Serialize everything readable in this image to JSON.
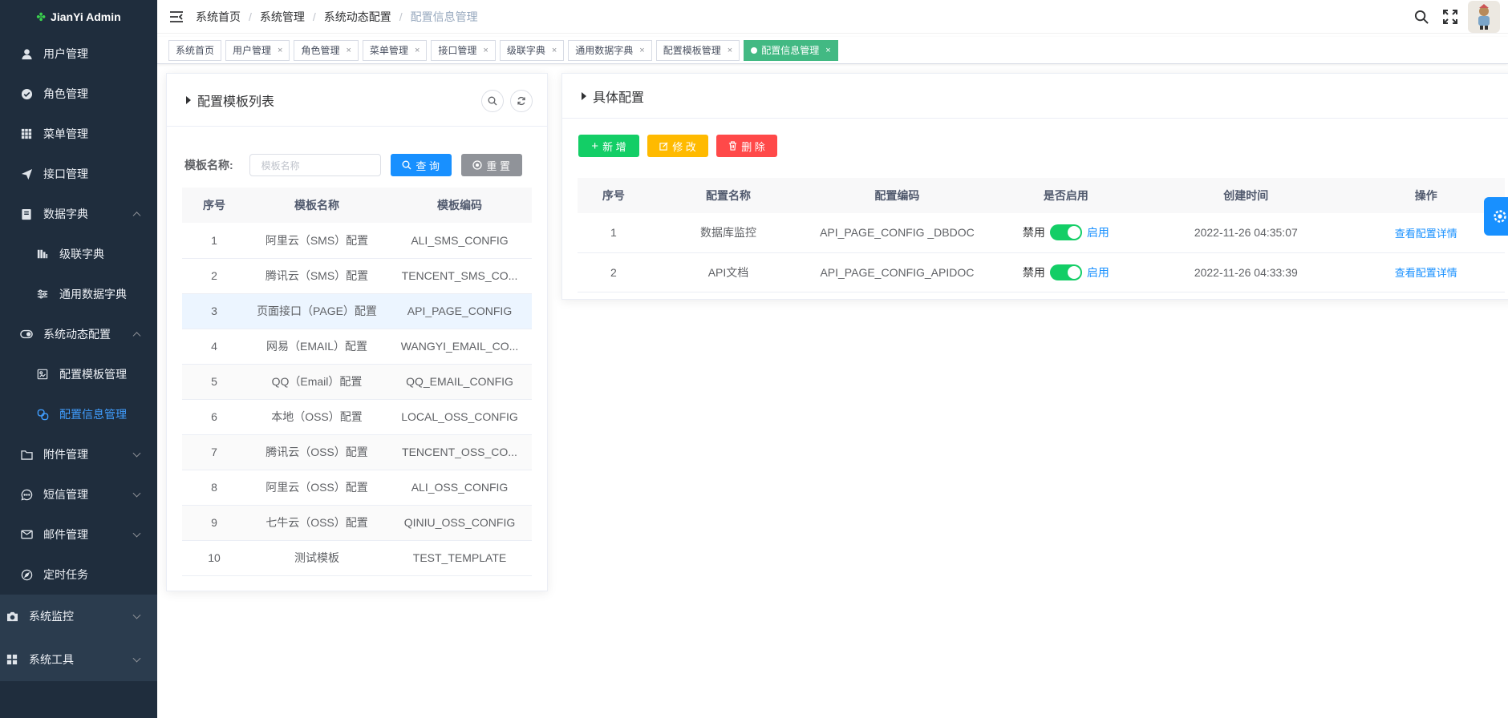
{
  "app": {
    "title": "JianYi Admin"
  },
  "sidebar": {
    "items": [
      {
        "label": "用户管理",
        "icon": "user-icon"
      },
      {
        "label": "角色管理",
        "icon": "check-circle-icon"
      },
      {
        "label": "菜单管理",
        "icon": "grid-icon"
      },
      {
        "label": "接口管理",
        "icon": "send-icon"
      },
      {
        "label": "数据字典",
        "icon": "book-icon"
      },
      {
        "label": "级联字典",
        "icon": "bar-icon"
      },
      {
        "label": "通用数据字典",
        "icon": "sliders-icon"
      },
      {
        "label": "系统动态配置",
        "icon": "toggle-icon"
      },
      {
        "label": "配置模板管理",
        "icon": "template-icon"
      },
      {
        "label": "配置信息管理",
        "icon": "link-icon"
      },
      {
        "label": "附件管理",
        "icon": "folder-icon"
      },
      {
        "label": "短信管理",
        "icon": "message-icon"
      },
      {
        "label": "邮件管理",
        "icon": "mail-icon"
      },
      {
        "label": "定时任务",
        "icon": "compass-icon"
      },
      {
        "label": "系统监控",
        "icon": "camera-icon"
      },
      {
        "label": "系统工具",
        "icon": "apps-icon"
      }
    ]
  },
  "breadcrumb": [
    "系统首页",
    "系统管理",
    "系统动态配置",
    "配置信息管理"
  ],
  "breadcrumb_sep": "/",
  "tags": [
    "系统首页",
    "用户管理",
    "角色管理",
    "菜单管理",
    "接口管理",
    "级联字典",
    "通用数据字典",
    "配置模板管理",
    "配置信息管理"
  ],
  "tag_close": "×",
  "left": {
    "title": "配置模板列表",
    "search_label": "模板名称:",
    "search_placeholder": "模板名称",
    "query_label": "查 询",
    "reset_label": "重 置",
    "columns": [
      "序号",
      "模板名称",
      "模板编码"
    ],
    "rows": [
      [
        "1",
        "阿里云（SMS）配置",
        "ALI_SMS_CONFIG"
      ],
      [
        "2",
        "腾讯云（SMS）配置",
        "TENCENT_SMS_CO..."
      ],
      [
        "3",
        "页面接口（PAGE）配置",
        "API_PAGE_CONFIG"
      ],
      [
        "4",
        "网易（EMAIL）配置",
        "WANGYI_EMAIL_CO..."
      ],
      [
        "5",
        "QQ（Email）配置",
        "QQ_EMAIL_CONFIG"
      ],
      [
        "6",
        "本地（OSS）配置",
        "LOCAL_OSS_CONFIG"
      ],
      [
        "7",
        "腾讯云（OSS）配置",
        "TENCENT_OSS_CO..."
      ],
      [
        "8",
        "阿里云（OSS）配置",
        "ALI_OSS_CONFIG"
      ],
      [
        "9",
        "七牛云（OSS）配置",
        "QINIU_OSS_CONFIG"
      ],
      [
        "10",
        "测试模板",
        "TEST_TEMPLATE"
      ]
    ]
  },
  "right": {
    "title": "具体配置",
    "add_label": "新 增",
    "edit_label": "修 改",
    "delete_label": "删 除",
    "columns": [
      "序号",
      "配置名称",
      "配置编码",
      "是否启用",
      "创建时间",
      "操作"
    ],
    "rows": [
      {
        "index": "1",
        "name": "数据库监控",
        "code": "API_PAGE_CONFIG _DBDOC",
        "off": "禁用",
        "on": "启用",
        "enabled": true,
        "time": "2022-11-26 04:35:07",
        "action": "查看配置详情"
      },
      {
        "index": "2",
        "name": "API文档",
        "code": "API_PAGE_CONFIG_APIDOC",
        "off": "禁用",
        "on": "启用",
        "enabled": true,
        "time": "2022-11-26 04:33:39",
        "action": "查看配置详情"
      }
    ]
  },
  "colors": {
    "sidebar_bg": "#1f2d3d",
    "active": "#409eff",
    "tag_active": "#42b983",
    "add": "#13ce66",
    "edit": "#ffba00",
    "delete": "#ff4949",
    "primary": "#1890ff"
  }
}
